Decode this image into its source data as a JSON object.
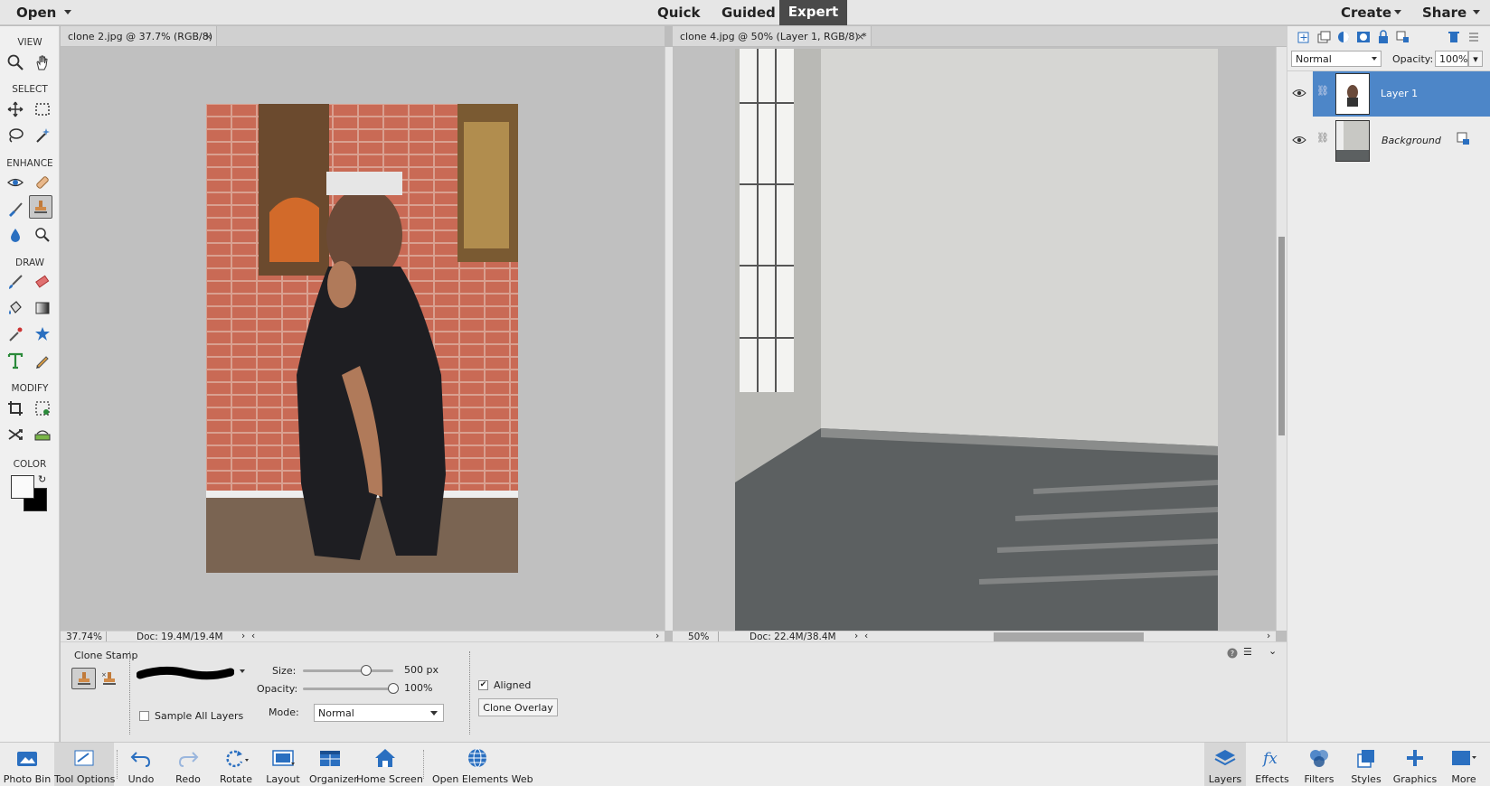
{
  "topbar": {
    "open_label": "Open",
    "modes": {
      "quick": "Quick",
      "guided": "Guided",
      "expert": "Expert"
    },
    "create_label": "Create",
    "share_label": "Share"
  },
  "toolbox": {
    "sections": {
      "view": "VIEW",
      "select": "SELECT",
      "enhance": "ENHANCE",
      "draw": "DRAW",
      "modify": "MODIFY",
      "color": "COLOR"
    }
  },
  "documents": [
    {
      "tab": "clone 2.jpg @ 37.7% (RGB/8)",
      "zoom": "37.74%",
      "doc": "Doc: 19.4M/19.4M"
    },
    {
      "tab": "clone 4.jpg @ 50% (Layer 1, RGB/8) *",
      "zoom": "50%",
      "doc": "Doc: 22.4M/38.4M"
    }
  ],
  "layers_panel": {
    "blend_mode": "Normal",
    "opacity_label": "Opacity:",
    "opacity_value": "100%",
    "layers": [
      {
        "name": "Layer 1",
        "selected": true
      },
      {
        "name": "Background",
        "selected": false
      }
    ]
  },
  "tool_options": {
    "tool_name": "Clone Stamp",
    "size_label": "Size:",
    "size_value": "500 px",
    "size_level": 0.7,
    "opacity_label": "Opacity:",
    "opacity_value": "100%",
    "opacity_level": 1.0,
    "mode_label": "Mode:",
    "mode_value": "Normal",
    "sample_all_layers": "Sample All Layers",
    "aligned": "Aligned",
    "clone_overlay": "Clone Overlay"
  },
  "dock": {
    "left": [
      "Photo Bin",
      "Tool Options",
      "Undo",
      "Redo",
      "Rotate",
      "Layout",
      "Organizer",
      "Home Screen",
      "Open Elements Web"
    ],
    "right": [
      "Layers",
      "Effects",
      "Filters",
      "Styles",
      "Graphics",
      "More"
    ]
  },
  "colors": {
    "accent": "#4d86c8",
    "selected_layer": "#4d86c8",
    "expert_bg": "#4a4a4a"
  }
}
